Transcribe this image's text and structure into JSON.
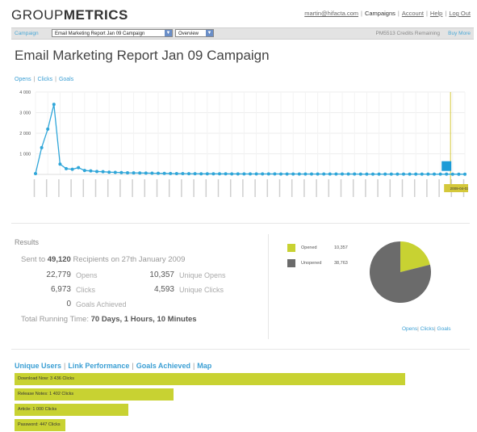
{
  "header": {
    "logo_part1": "GROUP",
    "logo_part2": "METRICS",
    "email_link": "martin@hifacta.com",
    "campaigns_link": "Campaigns",
    "account_link": "Account",
    "help_link": "Help",
    "logout_link": "Log Out",
    "separator": "|"
  },
  "navbar": {
    "label": "Campaign",
    "campaign_select": "Email Marketing Report Jan 09 Campaign",
    "view_select": "Overview",
    "credits_text": "PM5513 Credits Remaining",
    "buy_more": "Buy More"
  },
  "page_title": "Email Marketing Report Jan 09 Campaign",
  "chart_tabs": {
    "opens": "Opens",
    "clicks": "Clicks",
    "goals": "Goals",
    "separator": "|"
  },
  "chart_data": {
    "type": "line",
    "ylim": [
      0,
      4000
    ],
    "y_ticks": [
      "4 000",
      "3 000",
      "2 000",
      "1 000"
    ],
    "y_tick_values": [
      4000,
      3000,
      2000,
      1000
    ],
    "series": [
      {
        "values": [
          40,
          1300,
          2200,
          3400,
          500,
          280,
          250,
          330,
          190,
          170,
          140,
          130,
          110,
          100,
          90,
          80,
          75,
          70,
          65,
          60,
          55,
          50,
          45,
          40,
          40,
          35,
          35,
          30,
          30,
          30,
          28,
          28,
          26,
          26,
          25,
          25,
          24,
          24,
          23,
          23,
          22,
          22,
          22,
          21,
          21,
          20,
          20,
          20,
          19,
          19,
          18,
          18,
          18,
          17,
          17,
          17,
          16,
          16,
          16,
          15,
          15,
          15,
          14,
          14,
          14,
          13,
          13,
          13,
          12,
          12,
          12
        ]
      }
    ],
    "marker_color": "#2fa6d9",
    "line_color": "#2fa6d9",
    "highlight_label": "2009-04-03",
    "highlight_box_color": "#1b9bd7",
    "highlight_line_color": "#d4c83a"
  },
  "results": {
    "title": "Results",
    "sent_prefix": "Sent to",
    "sent_count": "49,120",
    "sent_suffix": "Recipients on 27th January 2009",
    "opens_num": "22,779",
    "opens_lbl": "Opens",
    "unique_opens_num": "10,357",
    "unique_opens_lbl": "Unique Opens",
    "clicks_num": "6,973",
    "clicks_lbl": "Clicks",
    "unique_clicks_num": "4,593",
    "unique_clicks_lbl": "Unique Clicks",
    "goals_num": "0",
    "goals_lbl": "Goals Achieved",
    "running_prefix": "Total Running Time:",
    "running_value": "70 Days, 1 Hours, 10 Minutes"
  },
  "pie_chart": {
    "type": "pie",
    "slices": [
      {
        "label": "Opened",
        "value": 10357,
        "display": "10,357",
        "color": "#c8d232"
      },
      {
        "label": "Unopened",
        "value": 38763,
        "display": "38,763",
        "color": "#6b6b6b"
      }
    ],
    "links": {
      "opens": "Opens",
      "clicks": "Clicks",
      "goals": "Goals",
      "separator": "|"
    }
  },
  "bottom_tabs": {
    "unique_users": "Unique Users",
    "link_performance": "Link Performance",
    "goals_achieved": "Goals Achieved",
    "map": "Map",
    "separator": "|"
  },
  "link_bars": [
    {
      "label": "Download Now: 3 436 Clicks",
      "value": 3436
    },
    {
      "label": "Release Notes: 1 402 Clicks",
      "value": 1402
    },
    {
      "label": "Article: 1 000 Clicks",
      "value": 1000
    },
    {
      "label": "Password: 447 Clicks",
      "value": 447
    }
  ]
}
